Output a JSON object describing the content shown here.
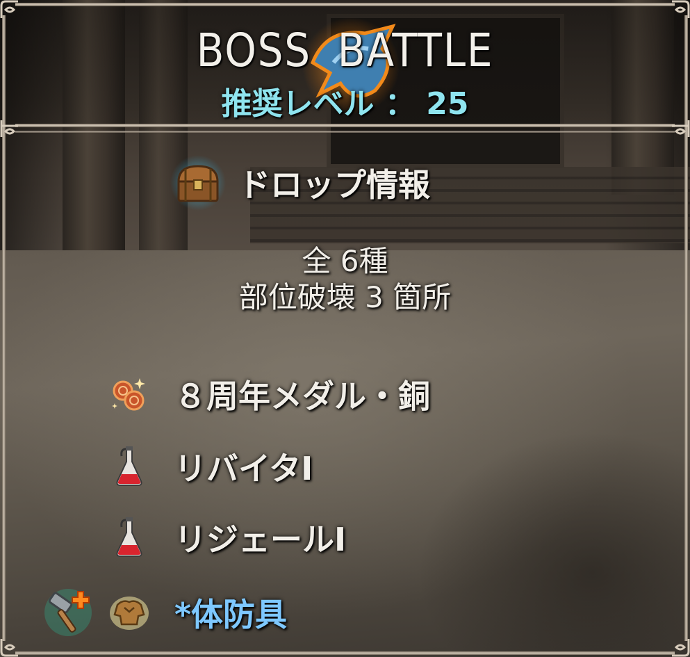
{
  "header": {
    "title": "BOSS  BATTLE",
    "recommended_level": "推奨レベル ： 25"
  },
  "drop_info": {
    "title": "ドロップ情報",
    "total_kinds": "全 6種",
    "part_break": "部位破壊 3 箇所"
  },
  "items": [
    {
      "label": "８周年メダル・銅",
      "icon": "bronze-medal-icon"
    },
    {
      "label": "リバイタⅠ",
      "icon": "potion-flask-icon"
    },
    {
      "label": "リジェールⅠ",
      "icon": "potion-flask-icon"
    },
    {
      "label": "*体防具",
      "icon": "body-armor-icon",
      "badge_icon": "hammer-plus-icon"
    }
  ],
  "colors": {
    "title": "#f3f0ea",
    "level": "#8fe4ef",
    "part_break_item": "#7ec8ff",
    "frame": "#d2c7b8"
  }
}
